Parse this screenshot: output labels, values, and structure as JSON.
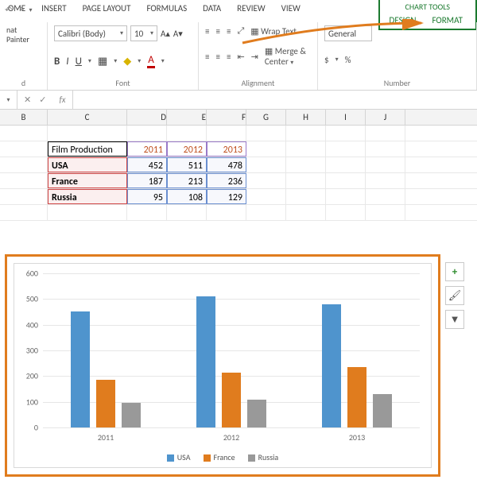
{
  "qat": {
    "undo": "↶",
    "redo": "↷"
  },
  "tabs": {
    "home": "OME",
    "insert": "INSERT",
    "page_layout": "PAGE LAYOUT",
    "formulas": "FORMULAS",
    "data": "DATA",
    "review": "REVIEW",
    "view": "VIEW",
    "chart_tools": "CHART TOOLS",
    "design": "DESIGN",
    "format": "FORMAT"
  },
  "ribbon": {
    "clipboard": {
      "format_painter": "nat Painter",
      "label": "d"
    },
    "font": {
      "name": "Calibri (Body)",
      "size": "10",
      "grow": "A▴",
      "shrink": "A▾",
      "bold": "B",
      "italic": "I",
      "underline": "U",
      "border": "▦",
      "fill": "◆",
      "color": "A",
      "label": "Font"
    },
    "alignment": {
      "wrap": "Wrap Text",
      "merge": "Merge & Center",
      "label": "Alignment"
    },
    "number": {
      "format": "General",
      "currency": "$",
      "percent": "%",
      "label": "Number"
    }
  },
  "fx": {
    "cancel": "✕",
    "enter": "✓",
    "fx": "fx"
  },
  "columns": [
    "B",
    "C",
    "D",
    "E",
    "F",
    "G",
    "H",
    "I",
    "J"
  ],
  "table": {
    "corner": "Film Production",
    "years": [
      "2011",
      "2012",
      "2013"
    ],
    "rows": [
      {
        "country": "USA",
        "values": [
          452,
          511,
          478
        ]
      },
      {
        "country": "France",
        "values": [
          187,
          213,
          236
        ]
      },
      {
        "country": "Russia",
        "values": [
          95,
          108,
          129
        ]
      }
    ]
  },
  "chart_data": {
    "type": "bar",
    "categories": [
      "2011",
      "2012",
      "2013"
    ],
    "series": [
      {
        "name": "USA",
        "values": [
          452,
          511,
          478
        ]
      },
      {
        "name": "France",
        "values": [
          187,
          213,
          236
        ]
      },
      {
        "name": "Russia",
        "values": [
          95,
          108,
          129
        ]
      }
    ],
    "ylim": [
      0,
      600
    ],
    "yticks": [
      0,
      100,
      200,
      300,
      400,
      500,
      600
    ],
    "title": "",
    "xlabel": "",
    "ylabel": ""
  },
  "side_buttons": {
    "add": "+",
    "brush": "🖌",
    "filter": "▼"
  }
}
